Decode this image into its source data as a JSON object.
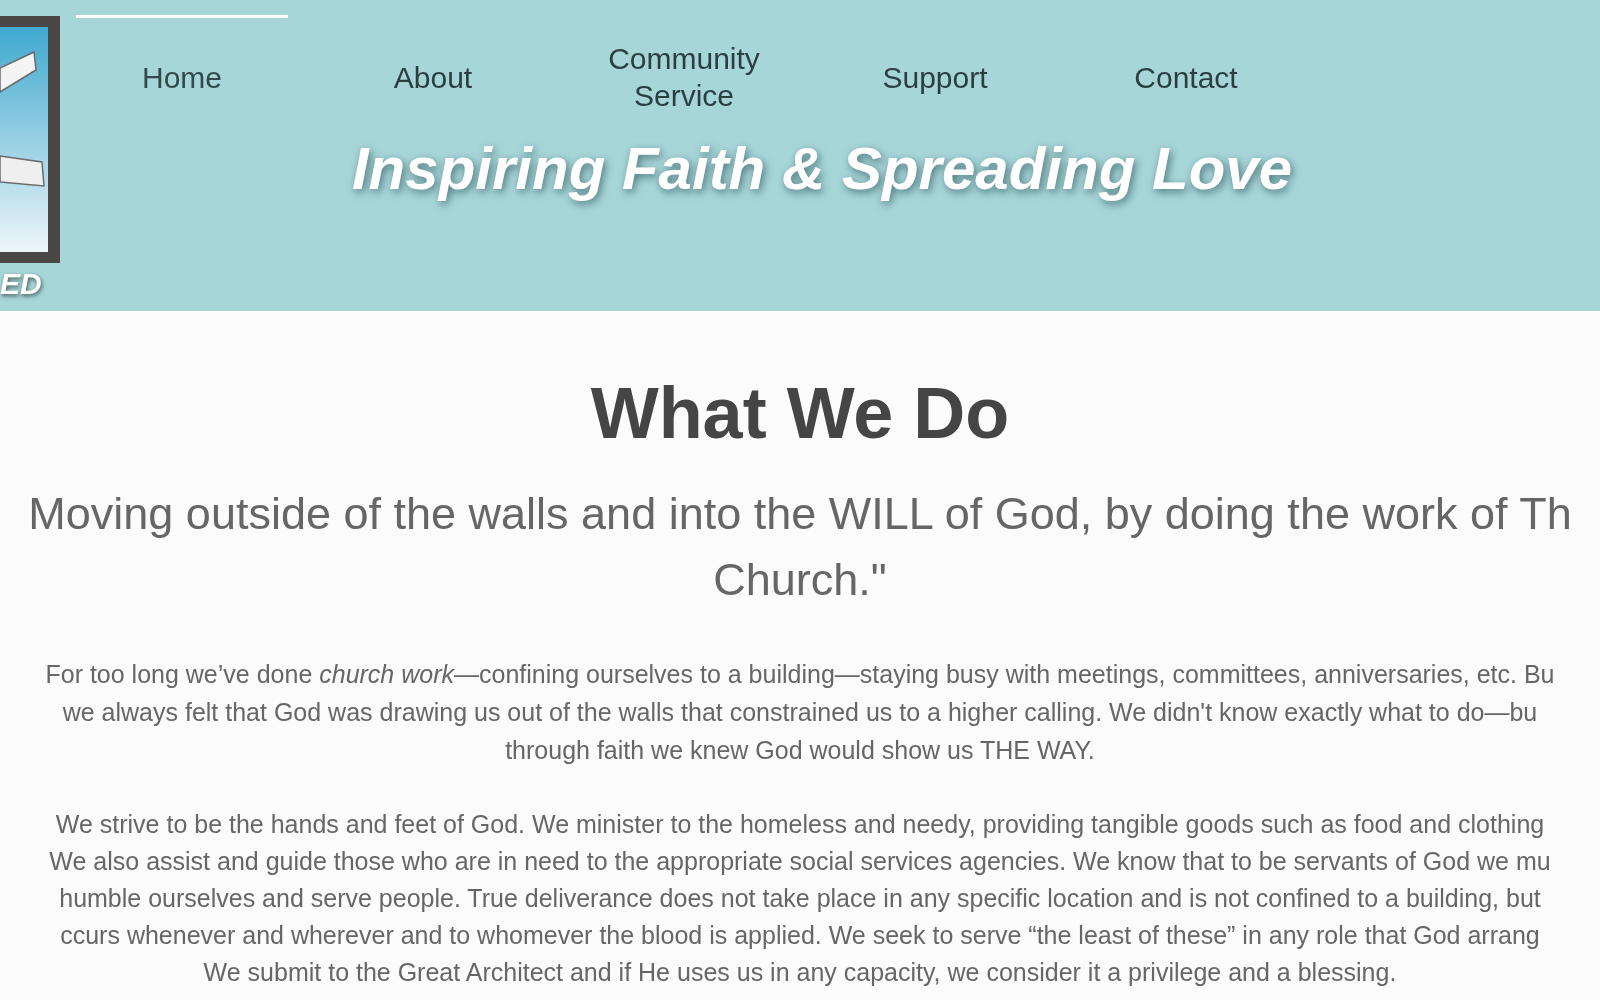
{
  "logo": {
    "caption": "ED"
  },
  "nav": [
    {
      "label": "Home",
      "selected": true
    },
    {
      "label": "About",
      "selected": false
    },
    {
      "label": "Community Service",
      "selected": false
    },
    {
      "label": "Support",
      "selected": false
    },
    {
      "label": "Contact",
      "selected": false
    }
  ],
  "tagline": "Inspiring Faith & Spreading Love",
  "section": {
    "heading": "What We Do",
    "quote": [
      "Moving outside of the walls and into the WILL of God, by doing the work of Th",
      "Church.\""
    ],
    "paragraphs": [
      [
        "For too long we’ve done *church work*—confining ourselves to a building—staying busy with meetings, committees, anniversaries, etc. Bu",
        "we always felt that God was drawing us out of the walls that constrained us to a higher calling. We didn't know exactly what to do—bu",
        "through faith we knew God would show us THE WAY."
      ],
      [
        "We strive to be the hands and feet of God. We minister to the homeless and needy, providing tangible goods such as food and clothing",
        "We also assist and guide those who are in need to the appropriate social services agencies.  We know that to be servants of God we mu",
        "humble ourselves and serve people. True deliverance does not take place in any specific location and is not confined to a building, but",
        "ccurs whenever and wherever and to whomever the blood is applied. We seek to serve “the least of these” in any role that God arrang",
        "We submit to the Great Architect and if He uses us in any capacity, we consider it a privilege and a blessing."
      ]
    ]
  }
}
